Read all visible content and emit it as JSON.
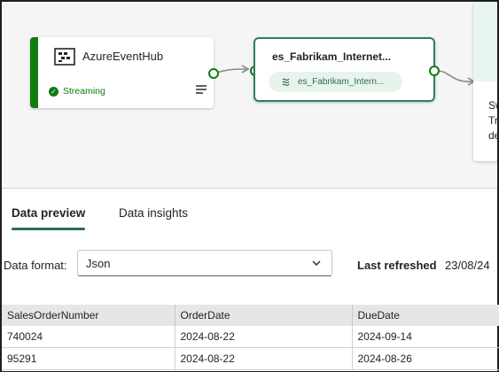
{
  "source_node": {
    "title": "AzureEventHub",
    "status": "Streaming",
    "status_color": "#107c10"
  },
  "stream_node": {
    "title": "es_Fabrikam_Internet...",
    "chip": "es_Fabrikam_Intern..."
  },
  "destination_node": {
    "text_partial": "Sw Tr de"
  },
  "tabs": [
    {
      "label": "Data preview",
      "active": true
    },
    {
      "label": "Data insights",
      "active": false
    }
  ],
  "data_format": {
    "label": "Data format:",
    "value": "Json"
  },
  "last_refreshed": {
    "label": "Last refreshed",
    "value": "23/08/24"
  },
  "table": {
    "columns": [
      "SalesOrderNumber",
      "OrderDate",
      "DueDate"
    ],
    "rows": [
      [
        "740024",
        "2024-08-22",
        "2024-09-14"
      ],
      [
        "95291",
        "2024-08-22",
        "2024-08-26"
      ]
    ]
  },
  "colors": {
    "accent": "#2f6b4f",
    "canvas_bg": "#f5f5f5"
  }
}
